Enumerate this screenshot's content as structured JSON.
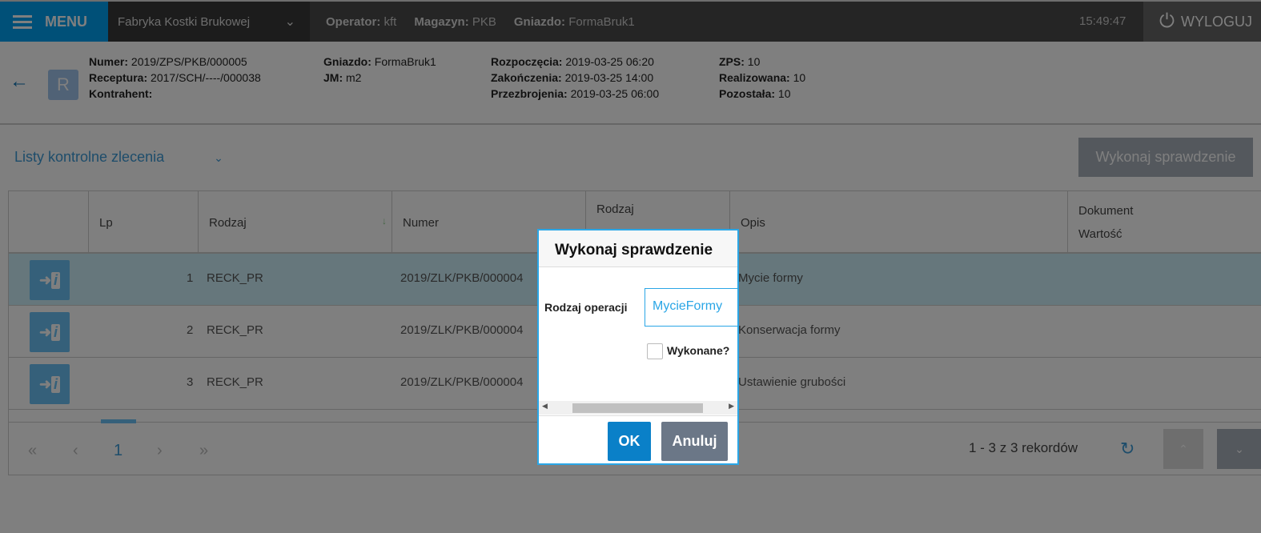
{
  "topbar": {
    "menu": "MENU",
    "firm": "Fabryka Kostki Brukowej",
    "operator_label": "Operator:",
    "operator": "kft",
    "magazyn_label": "Magazyn:",
    "magazyn": "PKB",
    "gniazdo_label": "Gniazdo:",
    "gniazdo": "FormaBruk1",
    "clock": "15:49:47",
    "logout": "WYLOGUJ"
  },
  "header": {
    "avatar": "R",
    "numer_l": "Numer:",
    "numer": "2019/ZPS/PKB/000005",
    "receptura_l": "Receptura:",
    "receptura": "2017/SCH/----/000038",
    "kontrahent_l": "Kontrahent:",
    "gniazdo_l": "Gniazdo:",
    "gniazdo": "FormaBruk1",
    "jm_l": "JM:",
    "jm": "m2",
    "rozp_l": "Rozpoczęcia:",
    "rozp": "2019-03-25 06:20",
    "zak_l": "Zakończenia:",
    "zak": "2019-03-25 14:00",
    "przez_l": "Przezbrojenia:",
    "przez": "2019-03-25 06:00",
    "zps_l": "ZPS:",
    "zps": "10",
    "real_l": "Realizowana:",
    "real": "10",
    "poz_l": "Pozostała:",
    "poz": "10"
  },
  "list_select": "Listy kontrolne zlecenia",
  "check_button": "Wykonaj sprawdzenie",
  "table": {
    "headers": {
      "lp": "Lp",
      "rodzaj": "Rodzaj",
      "numer": "Numer",
      "rodzaj2": "Rodzaj",
      "opis": "Opis",
      "dokument": "Dokument",
      "wartosc": "Wartość"
    },
    "rows": [
      {
        "lp": "1",
        "rodzaj": "RECK_PR",
        "numer": "2019/ZLK/PKB/000004",
        "opis": "Mycie formy"
      },
      {
        "lp": "2",
        "rodzaj": "RECK_PR",
        "numer": "2019/ZLK/PKB/000004",
        "opis": "Konserwacja formy"
      },
      {
        "lp": "3",
        "rodzaj": "RECK_PR",
        "numer": "2019/ZLK/PKB/000004",
        "opis": "Ustawienie grubości"
      }
    ],
    "page": "1",
    "records": "1 - 3 z 3 rekordów"
  },
  "dialog": {
    "title": "Wykonaj sprawdzenie",
    "label": "Rodzaj operacji",
    "value": "MycieFormy",
    "checkbox": "Wykonane?",
    "ok": "OK",
    "cancel": "Anuluj"
  }
}
